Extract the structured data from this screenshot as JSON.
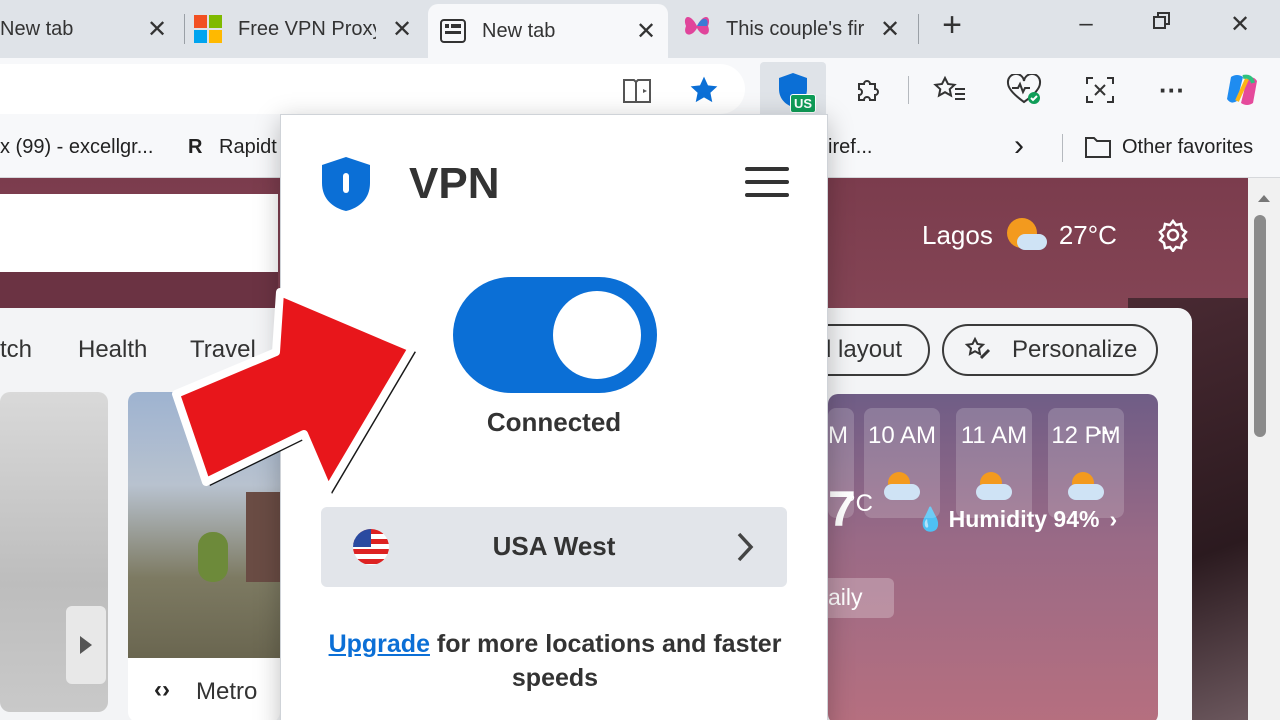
{
  "tabs": [
    {
      "title": "New tab",
      "active": false
    },
    {
      "title": "Free VPN Proxy",
      "active": false
    },
    {
      "title": "New tab",
      "active": true
    },
    {
      "title": "This couple's fir",
      "active": false
    }
  ],
  "new_tab_symbol": "+",
  "window": {
    "minimize": "–",
    "close": "✕"
  },
  "toolbar": {
    "vpn_badge": "US",
    "more_symbol": "···"
  },
  "favorites": {
    "items": [
      "x (99) - excellgr...",
      "Rapidt",
      "iref..."
    ],
    "overflow_symbol": "›",
    "other": "Other favorites"
  },
  "page": {
    "weather": {
      "city": "Lagos",
      "temp": "27°C"
    },
    "nav": [
      "tch",
      "Health",
      "Travel"
    ],
    "layout_btn": "d layout",
    "personalize_btn": "Personalize",
    "tile_source": "Metro",
    "weather_panel": {
      "more": "...",
      "temp_unit": "°C",
      "humidity": "Humidity 94%",
      "tab": "aily",
      "hours": [
        "M",
        "10 AM",
        "11 AM",
        "12 PM"
      ]
    }
  },
  "vpn": {
    "title": "VPN",
    "status": "Connected",
    "location": "USA West",
    "upgrade_link": "Upgrade",
    "upgrade_rest": " for more locations and faster speeds"
  },
  "colors": {
    "vpn_blue": "#0b6fd6",
    "arrow_red": "#e8161b",
    "page_bg": "#7b3c4d"
  },
  "icons": [
    "reader-icon",
    "favorite-star-icon",
    "vpn-shield-icon",
    "extensions-icon",
    "favorites-icon",
    "health-icon",
    "screenshot-icon",
    "copilot-icon",
    "folder-icon",
    "settings-gear-icon",
    "menu-icon",
    "us-flag-icon",
    "chevron-right-icon"
  ]
}
